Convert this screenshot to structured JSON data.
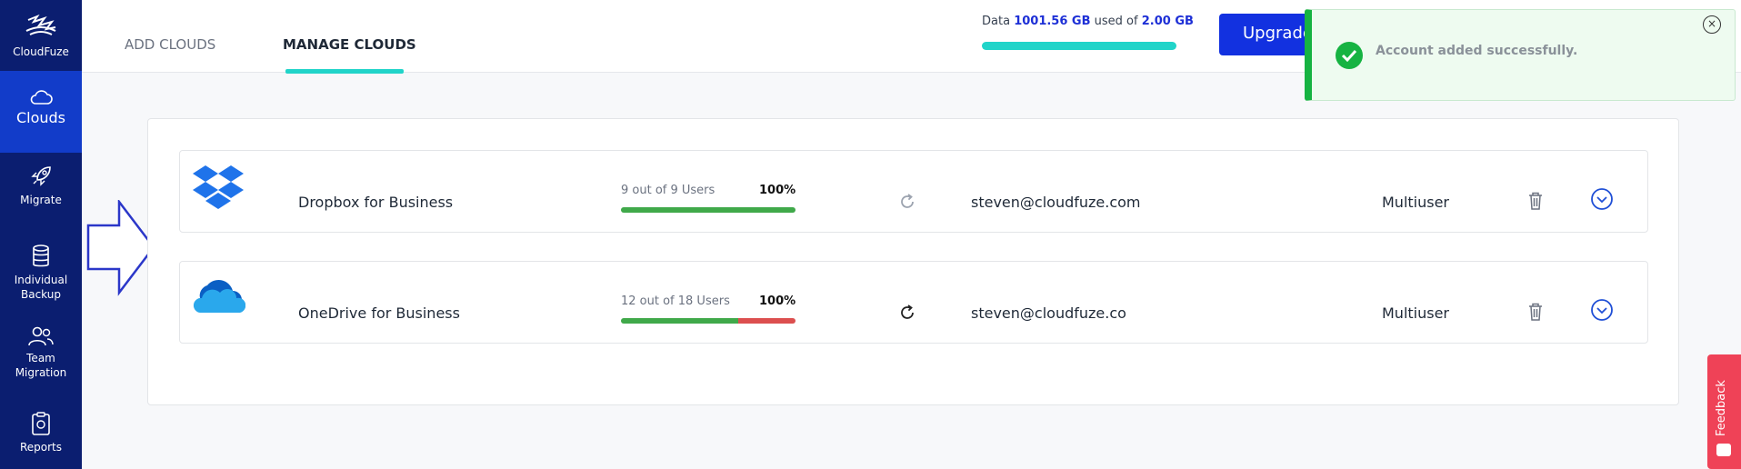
{
  "brand": {
    "name": "CloudFuze"
  },
  "sidebar": {
    "items": [
      {
        "id": "clouds",
        "label": "Clouds",
        "icon": "cloud-icon",
        "active": true
      },
      {
        "id": "migrate",
        "label": "Migrate",
        "icon": "rocket-icon"
      },
      {
        "id": "backup",
        "label": "Individual Backup",
        "icon": "database-icon"
      },
      {
        "id": "team",
        "label": "Team Migration",
        "icon": "users-icon"
      },
      {
        "id": "reports",
        "label": "Reports",
        "icon": "clipboard-icon"
      }
    ]
  },
  "tabs": [
    {
      "label": "ADD CLOUDS",
      "active": false
    },
    {
      "label": "MANAGE CLOUDS",
      "active": true
    }
  ],
  "usage": {
    "prefix": "Data",
    "used": "1001.56 GB",
    "middle": "used of",
    "total": "2.00 GB"
  },
  "upgrade_label": "Upgrade",
  "toast": {
    "message": "Account added successfully.",
    "close": "×"
  },
  "clouds": [
    {
      "name": "Dropbox for Business",
      "icon": "dropbox-icon",
      "users_text": "9 out of 9 Users",
      "percent": "100%",
      "ok_fraction": 1.0,
      "email": "steven@cloudfuze.com",
      "type": "Multiuser"
    },
    {
      "name": "OneDrive for Business",
      "icon": "onedrive-icon",
      "users_text": "12 out of 18 Users",
      "percent": "100%",
      "ok_fraction": 0.67,
      "email": "steven@cloudfuze.co",
      "type": "Multiuser"
    }
  ],
  "feedback_label": "Feedback",
  "colors": {
    "sidebar": "#0b1e70",
    "accent": "#21d4c9",
    "primary": "#1231e0",
    "success": "#16b342",
    "feedback": "#ef4257"
  }
}
